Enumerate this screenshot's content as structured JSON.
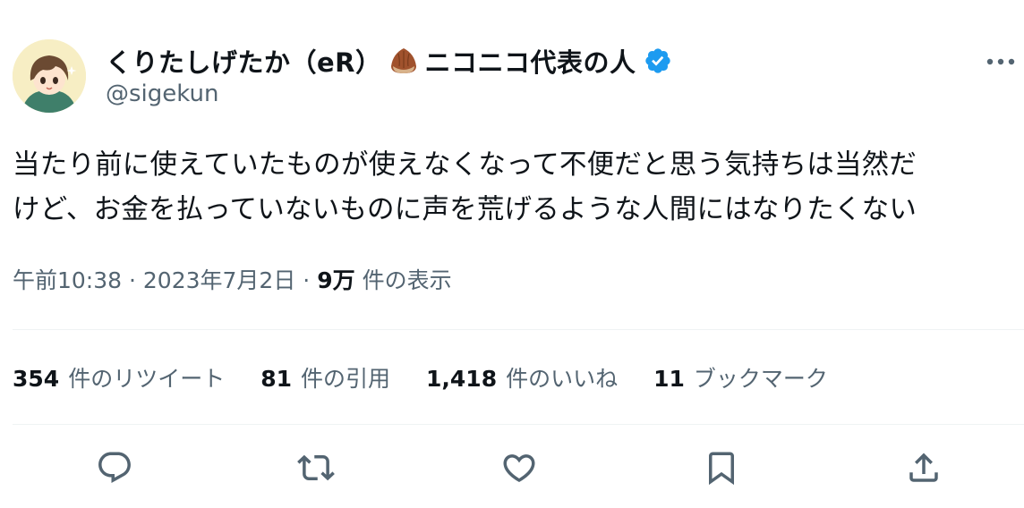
{
  "author": {
    "display_name": "くりたしげたか（eR）",
    "display_name_suffix": "ニコニコ代表の人",
    "handle": "@sigekun",
    "verified": true,
    "emoji_icon": "chestnut-icon"
  },
  "tweet": {
    "text_line1": "当たり前に使えていたものが使えなくなって不便だと思う気持ちは当然だ",
    "text_line2": "けど、お金を払っていないものに声を荒げるような人間にはなりたくない"
  },
  "meta": {
    "time": "午前10:38",
    "separator": "·",
    "date": "2023年7月2日",
    "views_count": "9万",
    "views_label": "件の表示"
  },
  "stats": [
    {
      "count": "354",
      "label": "件のリツイート"
    },
    {
      "count": "81",
      "label": "件の引用"
    },
    {
      "count": "1,418",
      "label": "件のいいね"
    },
    {
      "count": "11",
      "label": "ブックマーク"
    }
  ],
  "actions": [
    "reply-icon",
    "retweet-icon",
    "like-icon",
    "bookmark-icon",
    "share-icon"
  ],
  "colors": {
    "text": "#0f1419",
    "secondary": "#536471",
    "divider": "#eff3f4",
    "verified": "#1d9bf0"
  }
}
